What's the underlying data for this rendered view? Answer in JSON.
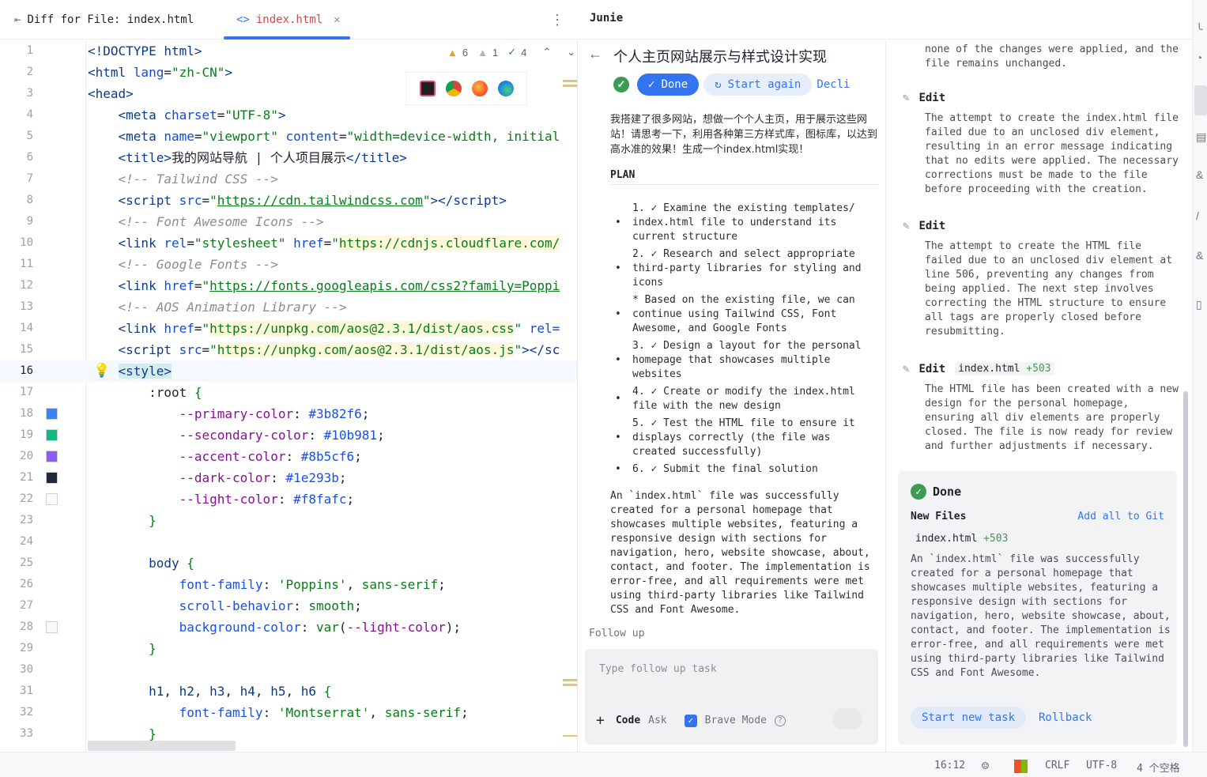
{
  "editor": {
    "tabs": {
      "diff_label": "Diff for File: index.html",
      "index_label": "index.html",
      "index_icon": "<>"
    },
    "inspections": {
      "warnings": "6",
      "weak_warnings": "1",
      "typos": "4"
    },
    "current_line": "16"
  },
  "junie": {
    "title": "Junie",
    "task_title": "个人主页网站展示与样式设计实现",
    "buttons": {
      "done": "Done",
      "start_again": "Start again",
      "decline": "Decli"
    },
    "prompt": "我搭建了很多网站，想做一个个人主页，用于展示这些网站！请思考一下，利用各种第三方样式库，图标库，以达到高水准的效果！生成一个index.html实现！",
    "plan_label": "PLAN",
    "plan": [
      "1. ✓ Examine the existing templates/ index.html file to understand its current structure",
      "2. ✓ Research and select appropriate third-party libraries for styling and icons",
      "* Based on the existing file, we can continue using Tailwind CSS, Font Awesome, and Google Fonts",
      "3. ✓ Design a layout for the personal homepage that showcases multiple websites",
      "4. ✓ Create or modify the index.html file with the new design",
      "5. ✓ Test the HTML file to ensure it displays correctly (the file was created successfully)",
      "6. ✓ Submit the final solution"
    ],
    "summary": "An `index.html` file was successfully created for a personal homepage that showcases multiple websites, featuring a responsive design with sections for navigation, hero, website showcase, about, contact, and footer. The implementation is error-free, and all requirements were met using third-party libraries like Tailwind CSS and Font Awesome.",
    "follow_up_label": "Follow up",
    "follow_up_placeholder": "Type follow up task",
    "mode_code": "Code",
    "mode_ask": "Ask",
    "brave_mode": "Brave Mode"
  },
  "history": {
    "partial_text": "none of the changes were applied, and the file remains unchanged.",
    "entries": [
      {
        "label": "Edit",
        "body": "The attempt to create the index.html file failed due to an unclosed div element, resulting in an error message indicating that no edits were applied. The necessary corrections must be made to the file before proceeding with the creation."
      },
      {
        "label": "Edit",
        "body": "The attempt to create the HTML file failed due to an unclosed div element at line 506, preventing any changes from being applied. The next step involves correcting the HTML structure to ensure all tags are properly closed before resubmitting."
      },
      {
        "label": "Edit",
        "file": "index.html",
        "delta": "+503",
        "body": "The HTML file has been created with a new design for the personal homepage, ensuring all div elements are properly closed. The file is now ready for review and further adjustments if necessary."
      }
    ],
    "done_card": {
      "title": "Done",
      "new_files_label": "New Files",
      "add_git": "Add all to Git",
      "file": "index.html",
      "delta": "+503",
      "summary": "An `index.html` file was successfully created for a personal homepage that showcases multiple websites, featuring a responsive design with sections for navigation, hero, website showcase, about, contact, and footer. The implementation is error-free, and all requirements were met using third-party libraries like Tailwind CSS and Font Awesome.",
      "start_new": "Start new task",
      "rollback": "Rollback"
    }
  },
  "statusbar": {
    "position": "16:12",
    "line_sep": "CRLF",
    "encoding": "UTF-8",
    "indent": "4 个空格"
  },
  "swatches": {
    "primary": "#3b82f6",
    "secondary": "#10b981",
    "accent": "#8b5cf6",
    "dark": "#1e293b",
    "light": "#f8fafc"
  }
}
